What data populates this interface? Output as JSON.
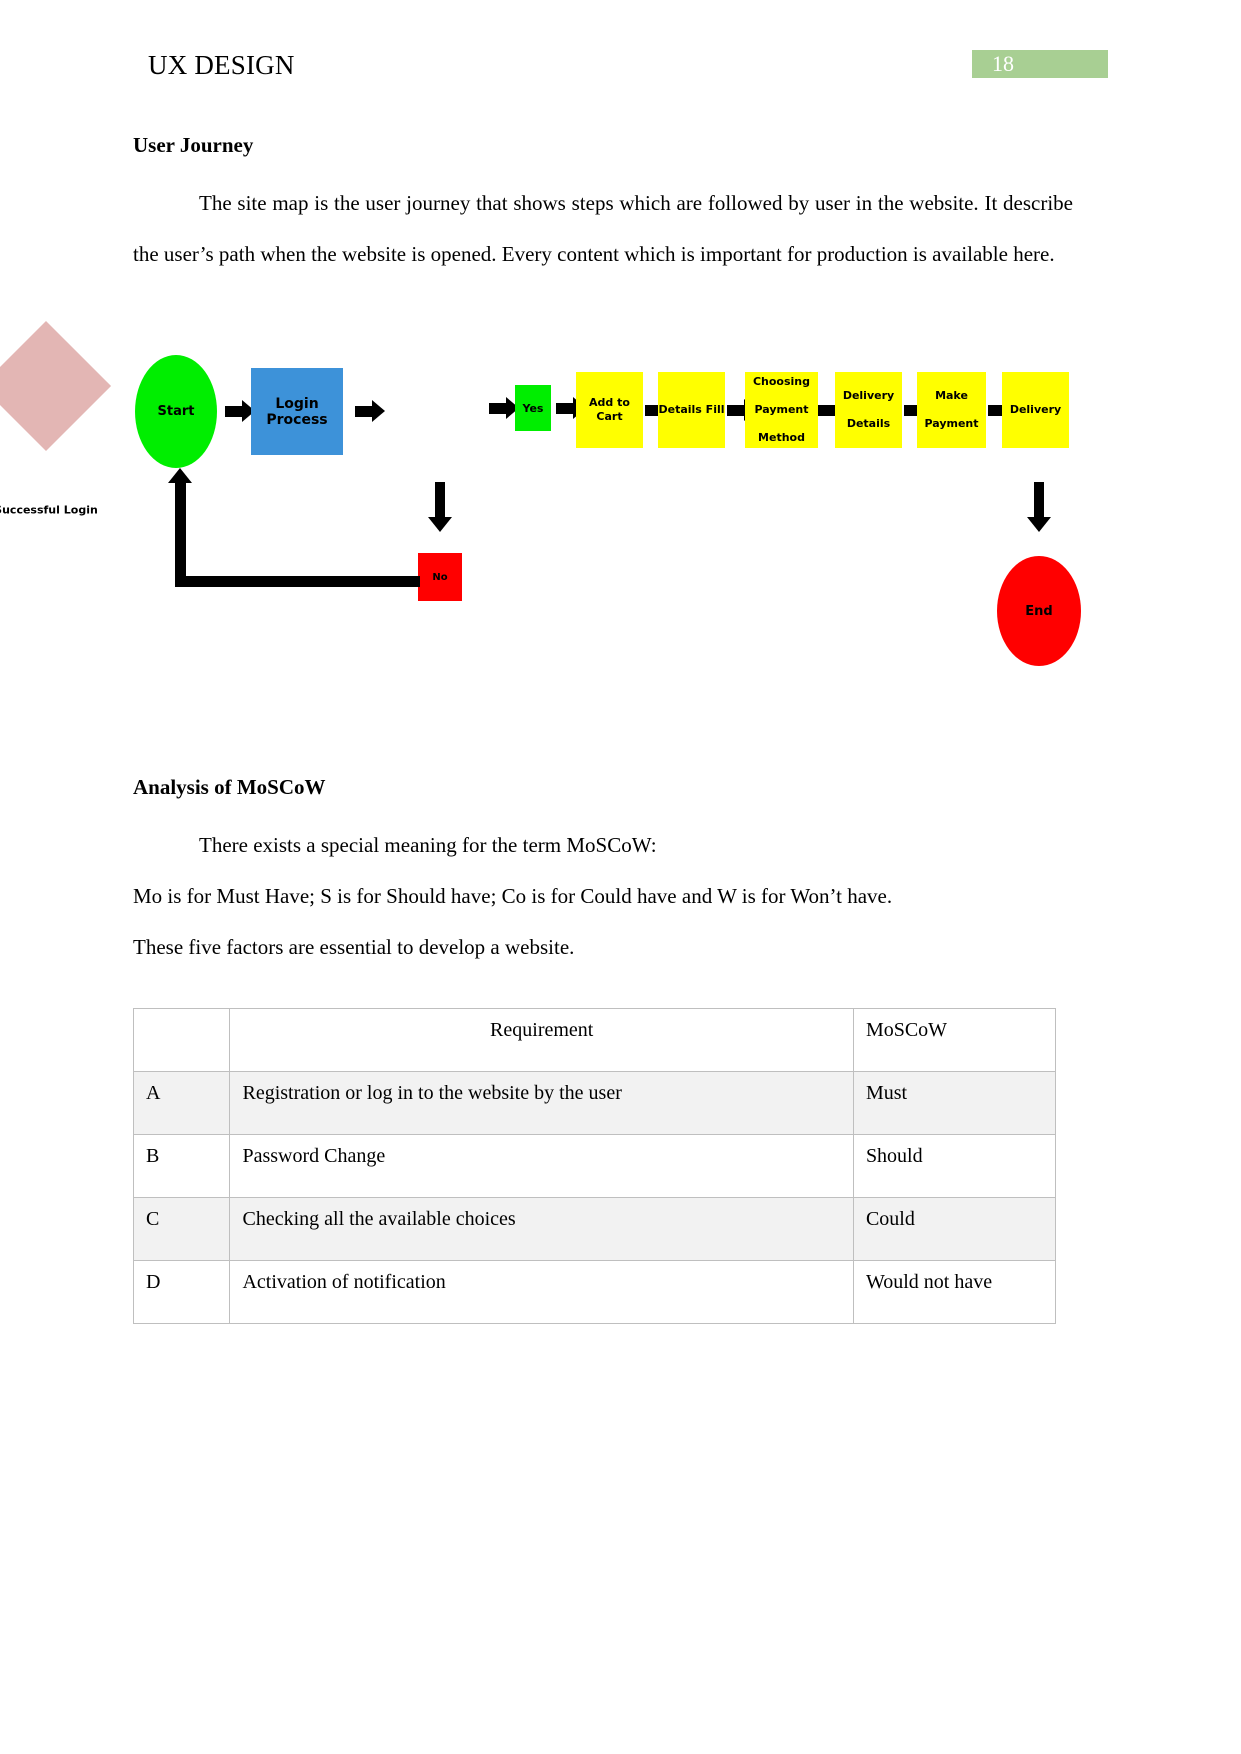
{
  "header": {
    "document_title": "UX DESIGN",
    "page_number": "18"
  },
  "sections": {
    "user_journey": {
      "heading": "User Journey",
      "paragraph_1": "The site map is the user journey that shows steps which are followed by user in the website. It describe the user’s path when the website is opened. Every content which is important for production is available here."
    },
    "moscow": {
      "heading": "Analysis of MoSCoW",
      "paragraph_1": "There exists a special meaning for the term MoSCoW:",
      "paragraph_2": "Mo is for Must Have; S is for Should have; Co is for Could have and W is for Won’t have.",
      "paragraph_3": "These five factors are essential to develop a website."
    }
  },
  "flowchart": {
    "nodes": {
      "start": "Start",
      "login_process": "Login Process",
      "successful_login": "Successful Login",
      "successful_login_line1": "Successful",
      "successful_login_line2": "Login",
      "yes": "Yes",
      "no": "No",
      "add_to_cart": "Add to Cart",
      "details_fill": "Details Fill",
      "choosing_payment_method": "Choosing Payment Method",
      "choosing_line1": "Choosing",
      "choosing_line2": "Payment",
      "choosing_line3": "Method",
      "delivery_details": "Delivery Details",
      "delivery_details_line1": "Delivery",
      "delivery_details_line2": "Details",
      "make_payment": "Make Payment",
      "make_payment_line1": "Make",
      "make_payment_line2": "Payment",
      "delivery": "Delivery",
      "end": "End"
    },
    "colors": {
      "start": "#00ee00",
      "login_process": "#3d92d9",
      "decision": "#e3b6b4",
      "yes": "#00ee00",
      "no": "#ff0000",
      "process": "#ffff00",
      "end": "#ff0000",
      "connector": "#000000"
    }
  },
  "table": {
    "columns": [
      "",
      "Requirement",
      "MoSCoW"
    ],
    "rows": [
      {
        "index": "A",
        "requirement": "Registration or log in to the website by the user",
        "moscow": "Must"
      },
      {
        "index": "B",
        "requirement": "Password Change",
        "moscow": "Should"
      },
      {
        "index": "C",
        "requirement": "Checking all the available choices",
        "moscow": "Could"
      },
      {
        "index": "D",
        "requirement": "Activation of notification",
        "moscow": "Would not have"
      }
    ]
  }
}
